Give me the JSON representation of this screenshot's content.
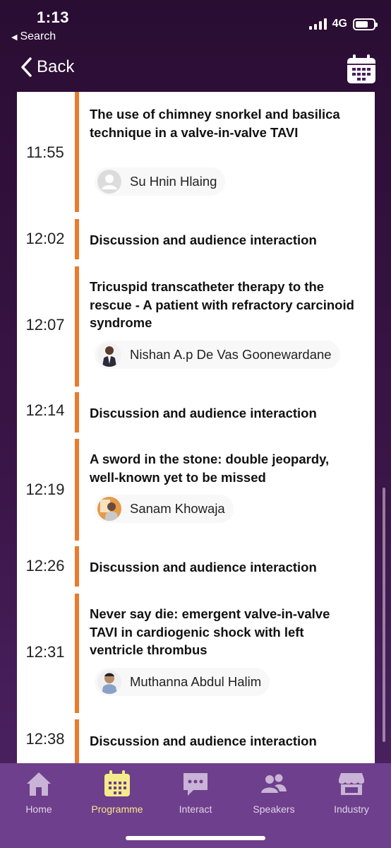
{
  "status_bar": {
    "time": "1:13",
    "back_app": "Search",
    "network": "4G"
  },
  "nav": {
    "back_label": "Back",
    "calendar_icon": "calendar-icon"
  },
  "schedule": [
    {
      "time": "11:55",
      "title": "The use of chimney snorkel and basilica technique in a valve-in-valve TAVI",
      "speaker": "Su Hnin Hlaing",
      "avatar": "default-user-icon"
    },
    {
      "time": "12:02",
      "title": "Discussion and audience interaction"
    },
    {
      "time": "12:07",
      "title": "Tricuspid transcatheter therapy to the rescue - A patient with refractory carcinoid syndrome",
      "speaker": "Nishan A.p De Vas Goonewardane",
      "avatar": "photo"
    },
    {
      "time": "12:14",
      "title": "Discussion and audience interaction"
    },
    {
      "time": "12:19",
      "title": "A sword in the stone: double jeopardy, well-known yet to be missed",
      "speaker": "Sanam Khowaja",
      "avatar": "photo"
    },
    {
      "time": "12:26",
      "title": "Discussion and audience interaction"
    },
    {
      "time": "12:31",
      "title": "Never say die: emergent valve-in-valve TAVI in cardiogenic shock with left ventricle thrombus",
      "speaker": "Muthanna Abdul Halim",
      "avatar": "photo"
    },
    {
      "time": "12:38",
      "title": "Discussion and audience interaction"
    }
  ],
  "tabs": [
    {
      "label": "Home",
      "icon": "home-icon"
    },
    {
      "label": "Programme",
      "icon": "calendar-icon",
      "active": true
    },
    {
      "label": "Interact",
      "icon": "chat-icon"
    },
    {
      "label": "Speakers",
      "icon": "people-icon"
    },
    {
      "label": "Industry",
      "icon": "store-icon"
    }
  ],
  "colors": {
    "accent_bar": "#ec7a2c",
    "tab_active": "#f4ec8a",
    "tabbar_bg": "#6e3f8c"
  }
}
